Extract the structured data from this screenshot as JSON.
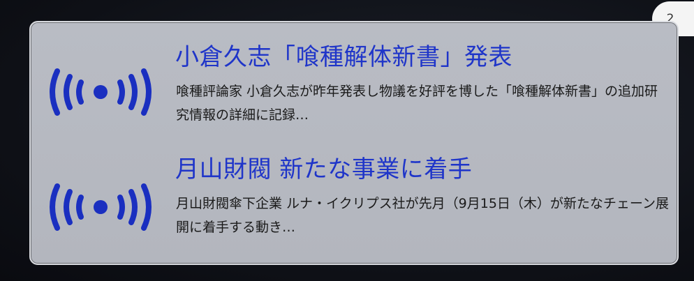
{
  "page_indicator": "2",
  "news": [
    {
      "title": "小倉久志「喰種解体新書」発表",
      "body": "喰種評論家 小倉久志が昨年発表し物議を好評を博した「喰種解体新書」の追加研究情報の詳細に記録…",
      "icon": "broadcast-icon"
    },
    {
      "title": "月山財閥 新たな事業に着手",
      "body": "月山財閥傘下企業 ルナ・イクリプス社が先月（9月15日（木）が新たなチェーン展開に着手する動き…",
      "icon": "broadcast-icon"
    }
  ],
  "colors": {
    "title": "#1f35c9",
    "icon": "#1a2fc0",
    "panel_background": "#b6b9c1",
    "panel_border": "#d9dbe0",
    "badge_background": "#f4f4f4"
  }
}
